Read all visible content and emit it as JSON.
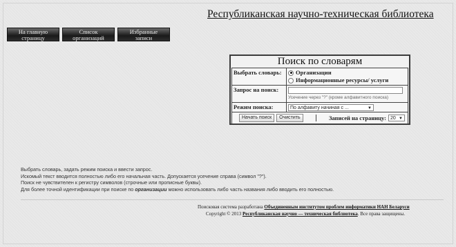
{
  "site": {
    "title": "Республиканская научно-техническая библиотека"
  },
  "nav": {
    "items": [
      {
        "line1": "На главную",
        "line2": "страницу"
      },
      {
        "line1": "Список",
        "line2": "организаций"
      },
      {
        "line1": "Избранные",
        "line2": "записи"
      }
    ]
  },
  "search": {
    "title": "Поиск по словарям",
    "dict_label": "Выбрать словарь:",
    "dict_options": [
      "Организации",
      "Информационные ресурсы/ услуги"
    ],
    "dict_selected": "Организации",
    "query_label": "Запрос на поиск:",
    "query_value": "",
    "query_hint": "Усечение через \"?\" (кроме алфавитного поиска)",
    "mode_label": "Режим поиска:",
    "mode_value": "По алфавиту начиная с ...",
    "start_button": "Начать поиск",
    "clear_button": "Очистить",
    "per_page_label": "Записей на страницу:",
    "per_page_value": "20"
  },
  "help": {
    "line1": "Выбрать словарь, задать режим поиска и ввести запрос.",
    "line2": "Искомый текст вводится полностью либо его начальная часть. Допускается усечение справа (символ \"?\").",
    "line3": "Поиск не чувствителен к регистру символов (строчные или прописные буквы).",
    "line4_pre": "Для более точной идентификации при поиске по ",
    "line4_bold": "организации",
    "line4_post": " можно использовать либо часть названия либо вводить его полностью."
  },
  "footer": {
    "line1_pre": "Поисковая система разработана",
    "line1_link": "Объединенным институтом проблем информатики НАН Беларуси",
    "line2_pre": "Copyright © 2013",
    "line2_link": "Республиканская научно — техническая библиотека",
    "line2_post": ". Все права защищены."
  }
}
